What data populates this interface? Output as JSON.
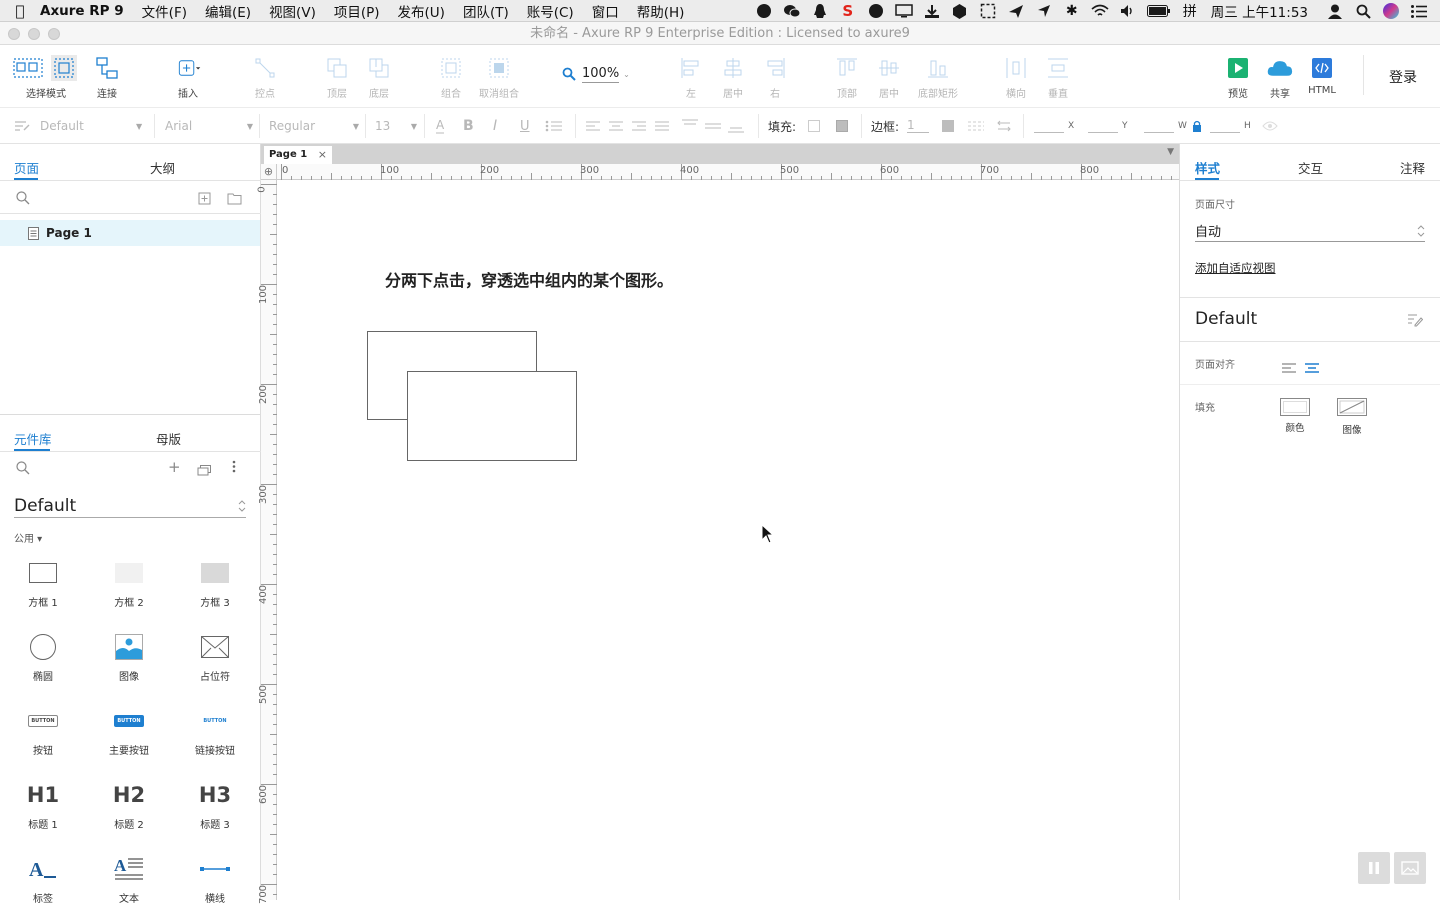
{
  "menubar": {
    "app_name": "Axure RP 9",
    "menus": [
      "文件(F)",
      "编辑(E)",
      "视图(V)",
      "项目(P)",
      "发布(U)",
      "团队(T)",
      "账号(C)",
      "窗口",
      "帮助(H)"
    ],
    "clock": "周三 上午11:53"
  },
  "window": {
    "title": "未命名 - Axure RP 9 Enterprise Edition : Licensed to axure9"
  },
  "toolbar": {
    "select_mode": "选择模式",
    "connect": "连接",
    "insert": "插入",
    "points": "控点",
    "top_layer": "顶层",
    "bottom_layer": "底层",
    "group": "组合",
    "ungroup": "取消组合",
    "zoom": "100%",
    "align_left": "左",
    "align_center": "居中",
    "align_right": "右",
    "align_top": "顶部",
    "align_middle": "居中",
    "align_bottom": "底部矩形",
    "distribute_h": "横向",
    "distribute_v": "垂直",
    "preview": "预览",
    "share": "共享",
    "html": "HTML",
    "login": "登录"
  },
  "formatbar": {
    "style": "Default",
    "font": "Arial",
    "weight": "Regular",
    "size": "13",
    "fill_label": "填充:",
    "border_label": "边框:",
    "border_value": "1",
    "x_label": "X",
    "y_label": "Y",
    "w_label": "W",
    "h_label": "H"
  },
  "pages_panel": {
    "tab_pages": "页面",
    "tab_outline": "大纲",
    "pages": [
      "Page 1"
    ]
  },
  "library_panel": {
    "tab_library": "元件库",
    "tab_masters": "母版",
    "library_name": "Default",
    "category": "公用 ▾",
    "widgets": [
      {
        "label": "方框 1",
        "icon": "box1"
      },
      {
        "label": "方框 2",
        "icon": "box2"
      },
      {
        "label": "方框 3",
        "icon": "box3"
      },
      {
        "label": "椭圆",
        "icon": "ellipse"
      },
      {
        "label": "图像",
        "icon": "image"
      },
      {
        "label": "占位符",
        "icon": "placeholder"
      },
      {
        "label": "按钮",
        "icon": "button"
      },
      {
        "label": "主要按钮",
        "icon": "primary-button"
      },
      {
        "label": "链接按钮",
        "icon": "link-button"
      },
      {
        "label": "标题 1",
        "icon": "h1"
      },
      {
        "label": "标题 2",
        "icon": "h2"
      },
      {
        "label": "标题 3",
        "icon": "h3"
      },
      {
        "label": "标签",
        "icon": "label"
      },
      {
        "label": "文本",
        "icon": "text"
      },
      {
        "label": "横线",
        "icon": "hline"
      }
    ],
    "button_text": "BUTTON",
    "h1_text": "H1",
    "h2_text": "H2",
    "h3_text": "H3"
  },
  "canvas": {
    "page_tab": "Page 1",
    "instruction": "分两下点击，穿透选中组内的某个图形。",
    "ruler_h": [
      "0",
      "100",
      "200",
      "300",
      "400",
      "500",
      "600",
      "700",
      "800"
    ],
    "ruler_v": [
      "0",
      "100",
      "200",
      "300",
      "400",
      "500",
      "600",
      "700"
    ]
  },
  "right_panel": {
    "tab_style": "样式",
    "tab_interact": "交互",
    "tab_notes": "注释",
    "page_size_label": "页面尺寸",
    "page_size_value": "自动",
    "add_adaptive": "添加自适应视图",
    "style_name": "Default",
    "page_align_label": "页面对齐",
    "fill_label": "填充",
    "fill_color": "颜色",
    "fill_image": "图像"
  },
  "colors": {
    "accent": "#1e7fd0",
    "preview_green": "#1bb272",
    "share_blue": "#2d9cdb",
    "html_blue": "#2d7bdb"
  }
}
